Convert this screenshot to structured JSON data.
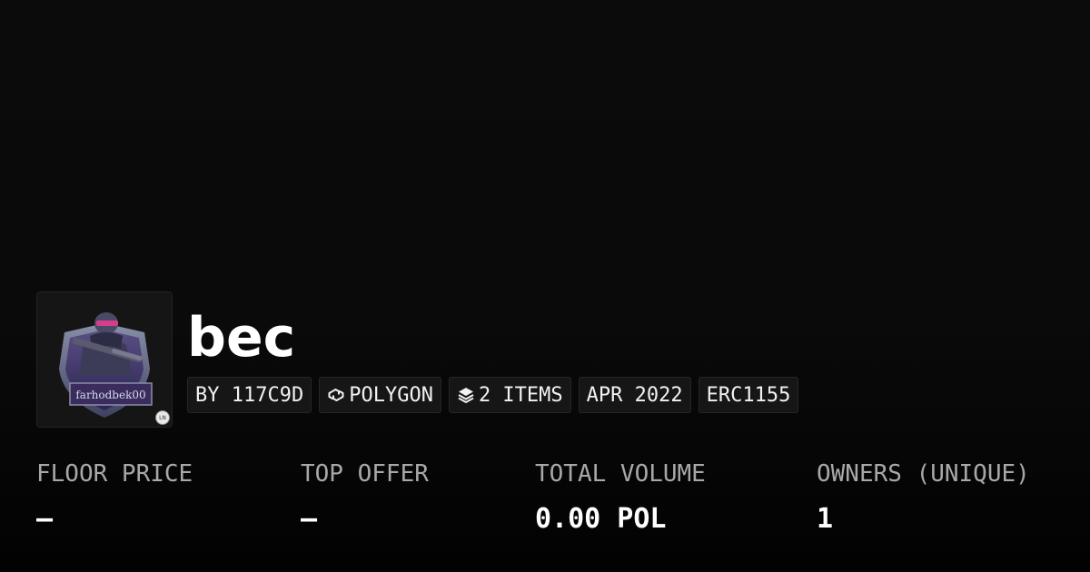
{
  "collection": {
    "name": "bec",
    "logo_text": "farhodbek00",
    "badge_icon": "verified-badge-icon"
  },
  "tags": {
    "creator": "BY 117C9D",
    "chain": "POLYGON",
    "chain_icon": "polygon-icon",
    "items": "2 ITEMS",
    "items_icon": "layers-icon",
    "date": "APR 2022",
    "standard": "ERC1155"
  },
  "stats": [
    {
      "label": "FLOOR PRICE",
      "value": "–"
    },
    {
      "label": "TOP OFFER",
      "value": "–"
    },
    {
      "label": "TOTAL VOLUME",
      "value": "0.00 POL"
    },
    {
      "label": "OWNERS (UNIQUE)",
      "value": "1"
    }
  ],
  "colors": {
    "background": "#0a0a0a",
    "label": "#a8a8a8",
    "value": "#ffffff",
    "tag_background": "#161616"
  }
}
